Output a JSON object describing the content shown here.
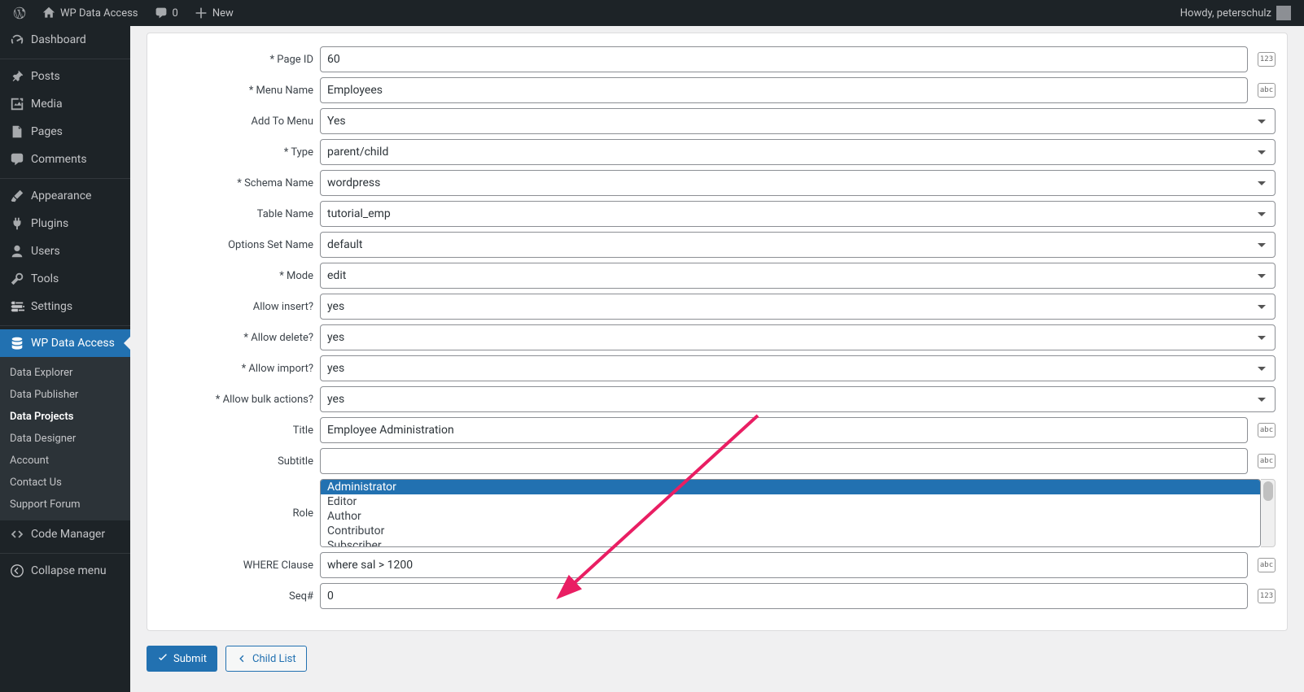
{
  "adminbar": {
    "site": "WP Data Access",
    "comments": "0",
    "new": "New",
    "howdy": "Howdy, peterschulz"
  },
  "sidebar": {
    "dashboard": "Dashboard",
    "posts": "Posts",
    "media": "Media",
    "pages": "Pages",
    "comments": "Comments",
    "appearance": "Appearance",
    "plugins": "Plugins",
    "users": "Users",
    "tools": "Tools",
    "settings": "Settings",
    "wpda": "WP Data Access",
    "sub_explorer": "Data Explorer",
    "sub_publisher": "Data Publisher",
    "sub_projects": "Data Projects",
    "sub_designer": "Data Designer",
    "sub_account": "Account",
    "sub_contact": "Contact Us",
    "sub_support": "Support Forum",
    "codemgr": "Code Manager",
    "collapse": "Collapse menu"
  },
  "form": {
    "page_id_label": "* Page ID",
    "page_id_value": "60",
    "menu_name_label": "* Menu Name",
    "menu_name_value": "Employees",
    "add_to_menu_label": "Add To Menu",
    "add_to_menu_value": "Yes",
    "type_label": "* Type",
    "type_value": "parent/child",
    "schema_label": "* Schema Name",
    "schema_value": "wordpress",
    "table_label": "Table Name",
    "table_value": "tutorial_emp",
    "options_label": "Options Set Name",
    "options_value": "default",
    "mode_label": "* Mode",
    "mode_value": "edit",
    "allow_insert_label": "Allow insert?",
    "allow_insert_value": "yes",
    "allow_delete_label": "* Allow delete?",
    "allow_delete_value": "yes",
    "allow_import_label": "* Allow import?",
    "allow_import_value": "yes",
    "allow_bulk_label": "* Allow bulk actions?",
    "allow_bulk_value": "yes",
    "title_label": "Title",
    "title_value": "Employee Administration",
    "subtitle_label": "Subtitle",
    "subtitle_value": "",
    "role_label": "Role",
    "roles": {
      "r0": "Administrator",
      "r1": "Editor",
      "r2": "Author",
      "r3": "Contributor",
      "r4": "Subscriber"
    },
    "where_label": "WHERE Clause",
    "where_value": "where sal > 1200",
    "seq_label": "Seq#",
    "seq_value": "0"
  },
  "actions": {
    "submit": "Submit",
    "childlist": "Child List"
  },
  "types": {
    "num": "123",
    "txt": "abc"
  }
}
